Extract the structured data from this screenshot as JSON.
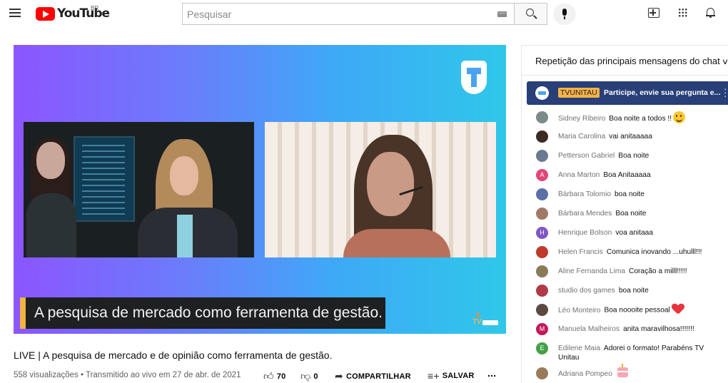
{
  "header": {
    "logo_text": "YouTube",
    "logo_country": "BR",
    "search_placeholder": "Pesquisar",
    "icons": [
      "menu-icon",
      "keyboard-icon",
      "search-icon",
      "microphone-icon",
      "create-video-icon",
      "apps-icon",
      "notifications-bell-icon"
    ]
  },
  "player": {
    "lower_third": "A pesquisa de mercado como ferramenta de gestão.",
    "watermark_text": "TV",
    "colors": {
      "gradient_start": "#8c55ff",
      "gradient_end": "#2fc7e9",
      "lower_third_accent": "#f0b340"
    }
  },
  "video": {
    "title": "LIVE | A pesquisa de mercado e de opinião como ferramenta de gestão.",
    "views": "558 visualizações • Transmitido ao vivo em 27 de abr. de 2021",
    "likes": "70",
    "dislikes": "0",
    "share_label": "COMPARTILHAR",
    "save_label": "SALVAR",
    "more_label": "..."
  },
  "chat": {
    "header": "Repetição das principais mensagens do chat",
    "pinned": {
      "author": "TVUNITAU",
      "message": "Participe, envie sua pergunta e...",
      "colors": {
        "background": "#283f78",
        "badge": "#f6b24a"
      }
    },
    "messages": [
      {
        "author": "Sidney Ribeiro",
        "text": "Boa noite a todos !!",
        "emoji": "smile",
        "avatar_color": "#7b8a8a",
        "initial": ""
      },
      {
        "author": "Maria Carolina",
        "text": "vai anitaaaaa",
        "emoji": "",
        "avatar_color": "#3d2a22",
        "initial": ""
      },
      {
        "author": "Petterson Gabriel",
        "text": "Boa noite",
        "emoji": "",
        "avatar_color": "#6b7a92",
        "initial": ""
      },
      {
        "author": "Anna Marton",
        "text": "Boa Anitaaaaa",
        "emoji": "",
        "avatar_color": "#e0457b",
        "initial": "A"
      },
      {
        "author": "Bárbara Tolomio",
        "text": "boa noite",
        "emoji": "",
        "avatar_color": "#5b6fa8",
        "initial": ""
      },
      {
        "author": "Bárbara Mendes",
        "text": "Boa noite",
        "emoji": "",
        "avatar_color": "#a07a66",
        "initial": ""
      },
      {
        "author": "Henrique Bolson",
        "text": "voa anitaaa",
        "emoji": "",
        "avatar_color": "#7e57c2",
        "initial": "H"
      },
      {
        "author": "Helen Francis",
        "text": "Comunica inovando ...uhulll!!!",
        "emoji": "",
        "avatar_color": "#c0392b",
        "initial": ""
      },
      {
        "author": "Aline Fernanda Lima",
        "text": "Coração a milll!!!!!",
        "emoji": "",
        "avatar_color": "#8a7a5a",
        "initial": ""
      },
      {
        "author": "studio dos games",
        "text": "boa noite",
        "emoji": "",
        "avatar_color": "#b03a48",
        "initial": ""
      },
      {
        "author": "Léo Monteiro",
        "text": "Boa noooite pessoal",
        "emoji": "heart",
        "avatar_color": "#5a4a40",
        "initial": ""
      },
      {
        "author": "Manuela Malheiros",
        "text": "anita maravilhosa!!!!!!!",
        "emoji": "",
        "avatar_color": "#c2185b",
        "initial": "M"
      },
      {
        "author": "Edilene Maia",
        "text": "Adorei o formato! Parabéns TV Unitau",
        "emoji": "",
        "avatar_color": "#43a047",
        "initial": "E"
      },
      {
        "author": "Adriana Pompeo",
        "text": "",
        "emoji": "cake",
        "avatar_color": "#9a7a5a",
        "initial": ""
      }
    ]
  }
}
